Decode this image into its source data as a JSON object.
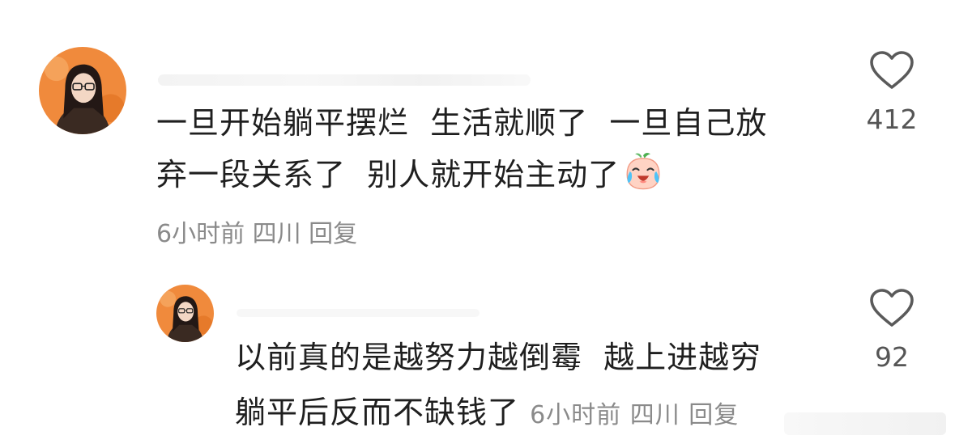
{
  "comments": [
    {
      "text_line1": "一旦开始躺平摆烂  生活就顺了  一旦自己放",
      "text_line2": "弃一段关系了  别人就开始主动了",
      "emoji": "crying-laughing-peach-emoji",
      "meta": "6小时前 四川 回复",
      "like_count": "412",
      "like_icon": "heart-outline-icon"
    },
    {
      "text_line1": "以前真的是越努力越倒霉  越上进越穷",
      "text_line2": "躺平后反而不缺钱了 ",
      "meta": "6小时前 四川 回复",
      "like_count": "92",
      "like_icon": "heart-outline-icon"
    }
  ],
  "colors": {
    "text": "#1f1f1f",
    "meta": "#8a8a8a",
    "count": "#555555",
    "avatar_bg": "#f08a3c"
  }
}
